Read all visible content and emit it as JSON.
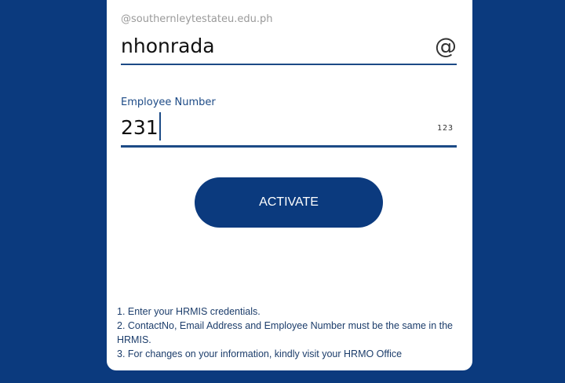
{
  "form": {
    "email_hint": "@southernleytestateu.edu.ph",
    "email_value": "nhonrada",
    "email_icon": "@",
    "employee_label": "Employee Number",
    "employee_value": "231",
    "numeric_icon": "123",
    "activate_label": "ACTIVATE"
  },
  "notes": [
    "1. Enter your HRMIS credentials.",
    "2. ContactNo, Email Address and Employee Number must be the same in the HRMIS.",
    "3. For changes on your information, kindly visit your HRMO Office"
  ],
  "colors": {
    "background": "#0b3a7e",
    "accent": "#1c4a86",
    "card": "#ffffff"
  }
}
